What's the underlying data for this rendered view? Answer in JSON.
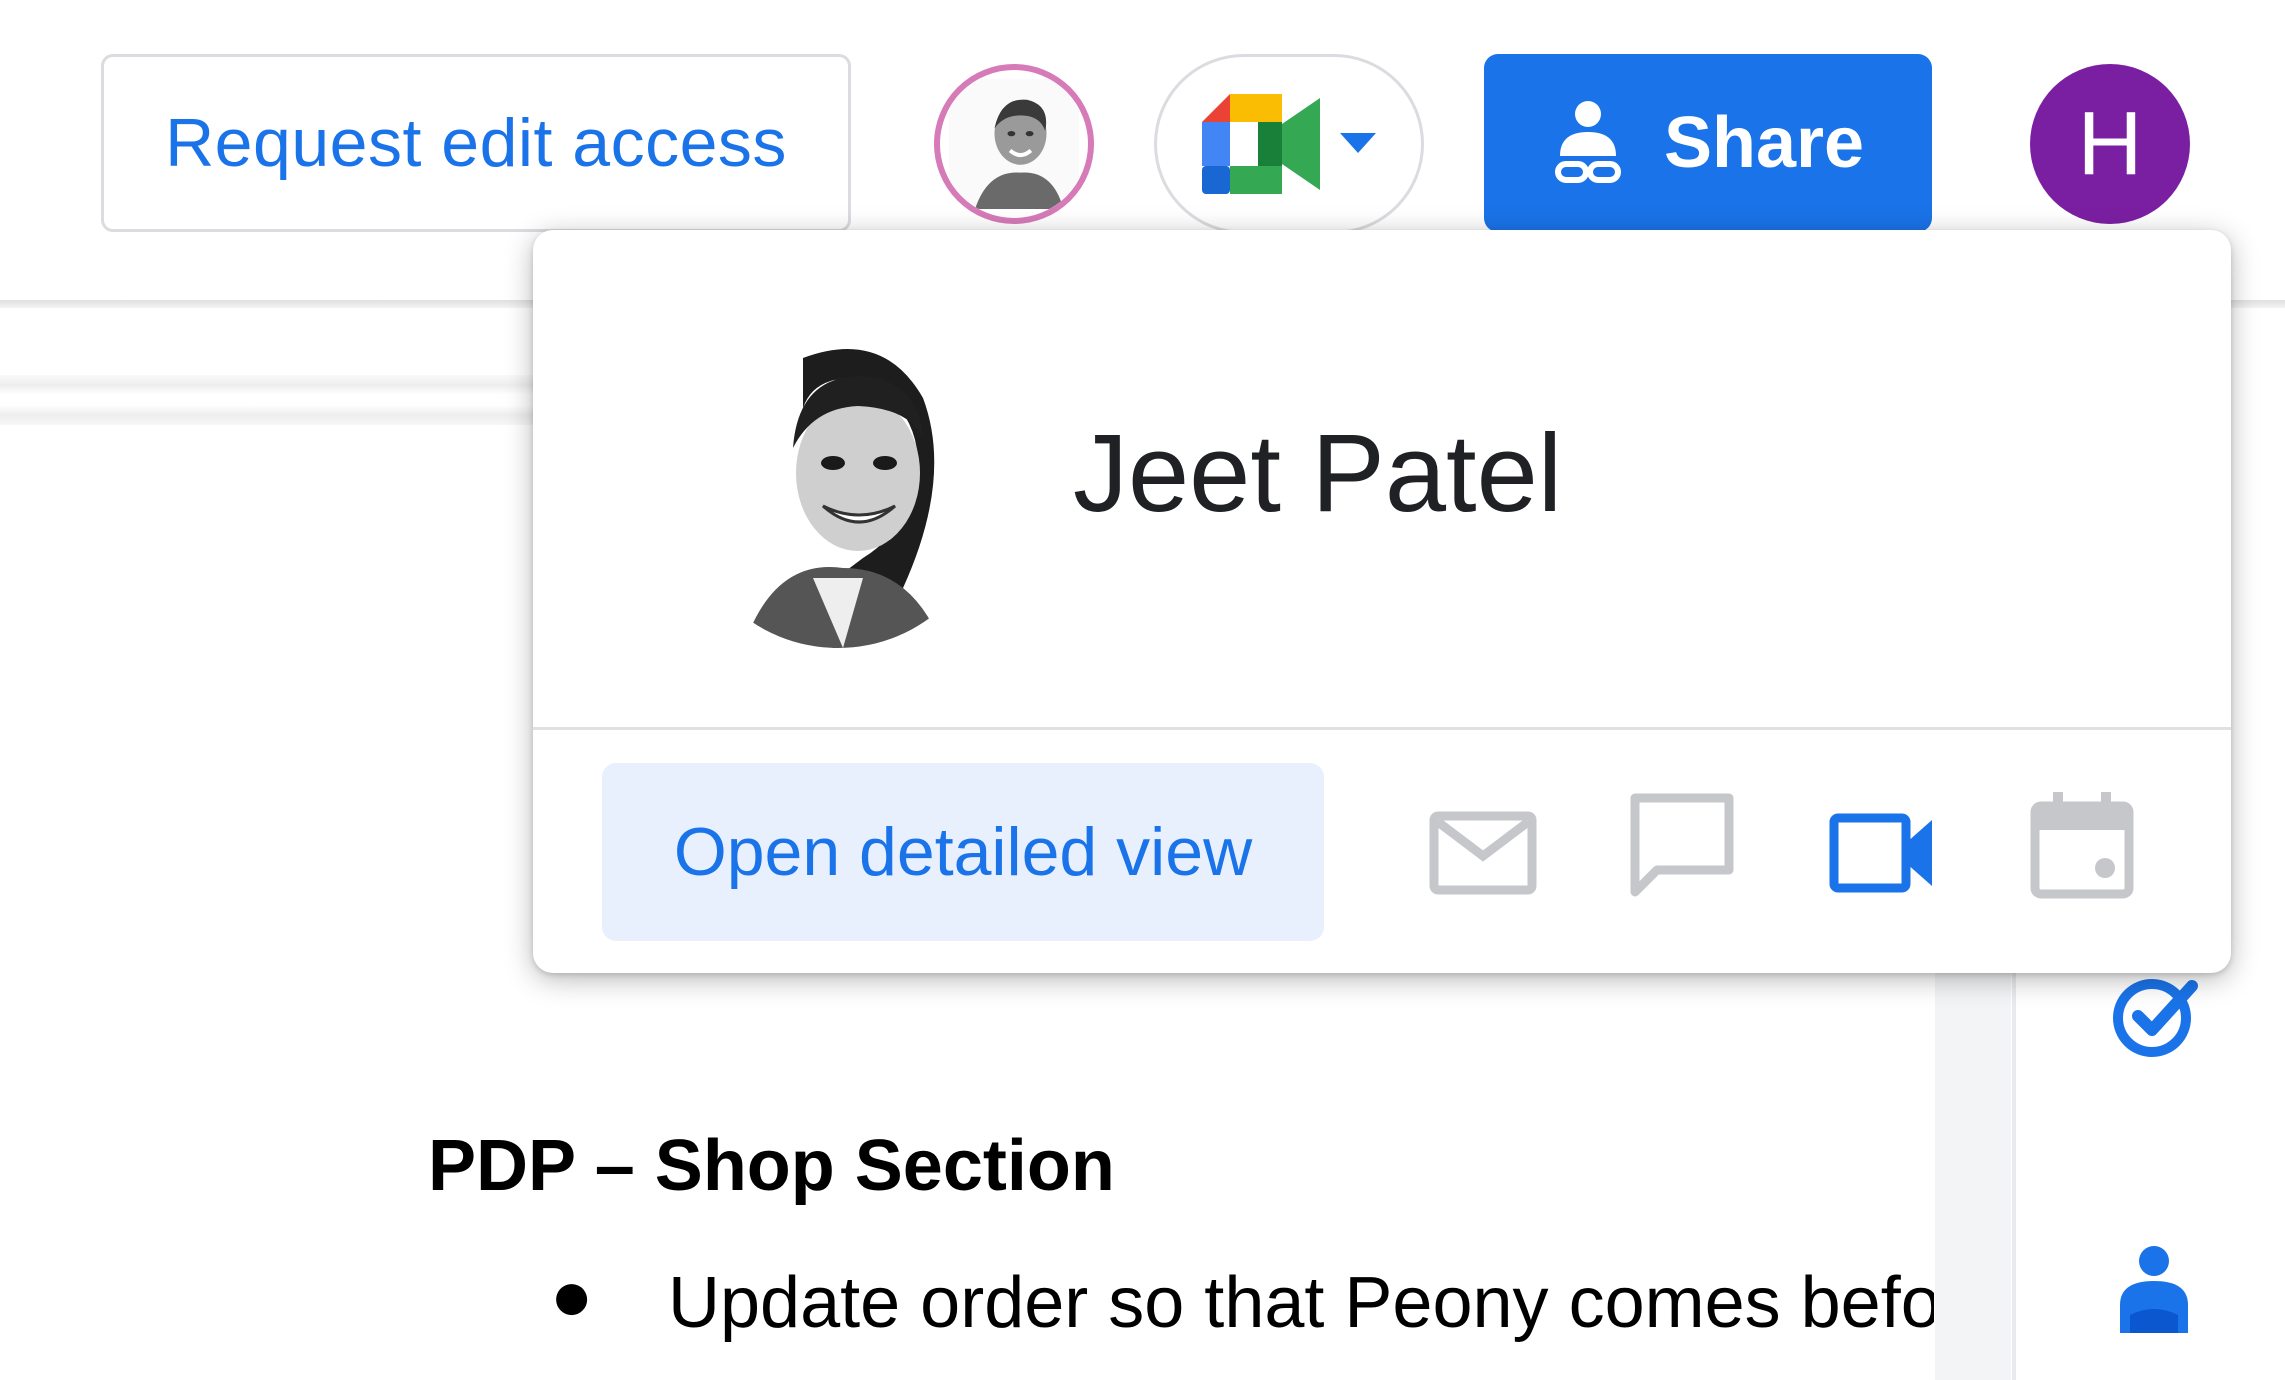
{
  "header": {
    "request_edit_access_label": "Request edit access",
    "share_label": "Share",
    "account_initial": "H"
  },
  "profile_card": {
    "name": "Jeet Patel",
    "open_detailed_view_label": "Open detailed view"
  },
  "document": {
    "heading": "PDP – Shop Section",
    "bullet_marker": "●",
    "bullet_text": "Update order so that Peony comes befo"
  },
  "colors": {
    "accent": "#1a73e8",
    "account_avatar": "#7b1fa2",
    "collaborator_ring": "#d67ab8"
  },
  "icons": [
    "meet-icon",
    "share-person-icon",
    "mail-icon",
    "chat-icon",
    "video-call-icon",
    "calendar-icon",
    "tasks-icon",
    "contacts-icon"
  ]
}
